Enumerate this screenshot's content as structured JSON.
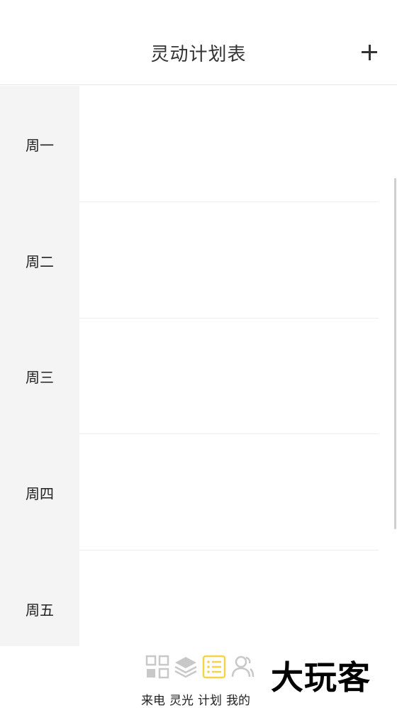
{
  "header": {
    "title": "灵动计划表",
    "add_icon": "plus-icon"
  },
  "schedule": {
    "days": [
      {
        "label": "周一"
      },
      {
        "label": "周二"
      },
      {
        "label": "周三"
      },
      {
        "label": "周四"
      },
      {
        "label": "周五"
      }
    ]
  },
  "bottom_nav": {
    "items": [
      {
        "label": "来电",
        "icon": "grid-icon",
        "active": false
      },
      {
        "label": "灵光",
        "icon": "layers-icon",
        "active": false
      },
      {
        "label": "计划",
        "icon": "list-icon",
        "active": true
      },
      {
        "label": "我的",
        "icon": "users-icon",
        "active": false
      }
    ],
    "active_color": "#f5d547",
    "inactive_color": "#c8c8c8"
  },
  "watermark": "大玩客"
}
